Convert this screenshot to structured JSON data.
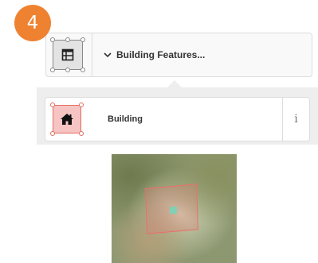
{
  "step": {
    "number": "4"
  },
  "preset_card": {
    "label": "Building Features...",
    "icon": "building-features-icon",
    "chevron": "chevron-down-icon"
  },
  "preset_list": {
    "items": [
      {
        "label": "Building",
        "icon": "house-icon",
        "info_label": "i"
      }
    ]
  },
  "map_thumbnail": {
    "feature": "area",
    "accent": "#e9706c",
    "node_color": "#7fd0b4"
  },
  "colors": {
    "badge": "#ee8231",
    "panel_background": "#eeeeee",
    "area_fill": "#f7c4c4"
  }
}
